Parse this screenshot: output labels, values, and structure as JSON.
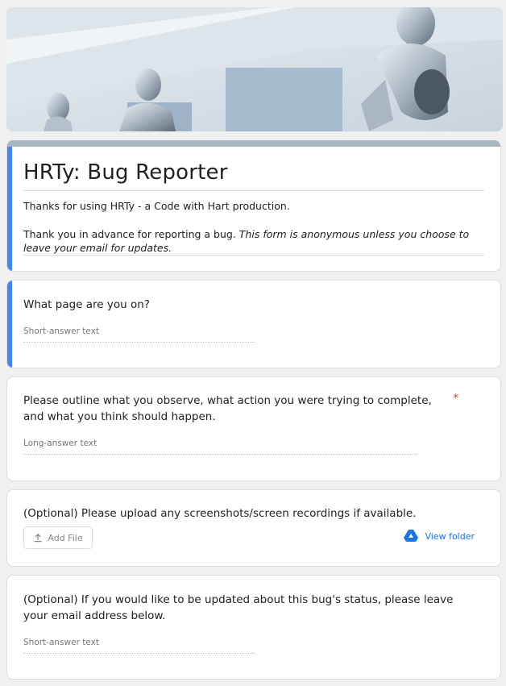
{
  "form": {
    "title": "HRTy: Bug Reporter",
    "description_line1": "Thanks for using HRTy - a Code with Hart production.",
    "description_line2_plain": "Thank you in advance for reporting a bug. ",
    "description_line2_italic": "This form is anonymous unless you choose to leave your email for updates."
  },
  "questions": [
    {
      "text": "What page are you on?",
      "placeholder": "Short-answer text",
      "required": false
    },
    {
      "text": "Please outline what you observe, what action you were trying to complete, and what you think should happen.",
      "placeholder": "Long-answer text",
      "required": true,
      "required_mark": "*"
    },
    {
      "text": "(Optional) Please upload any screenshots/screen recordings if available.",
      "add_file_label": "Add File",
      "view_folder_label": "View folder"
    },
    {
      "text": "(Optional) If you would like to be updated about this bug's status, please leave your email address below.",
      "placeholder": "Short-answer text",
      "required": false
    }
  ],
  "colors": {
    "accent": "#4285f4",
    "title_bar": "#a7b8be",
    "required": "#d93025",
    "link": "#1a73e8"
  },
  "icons": {
    "upload": "upload-icon",
    "drive": "google-drive-icon"
  }
}
